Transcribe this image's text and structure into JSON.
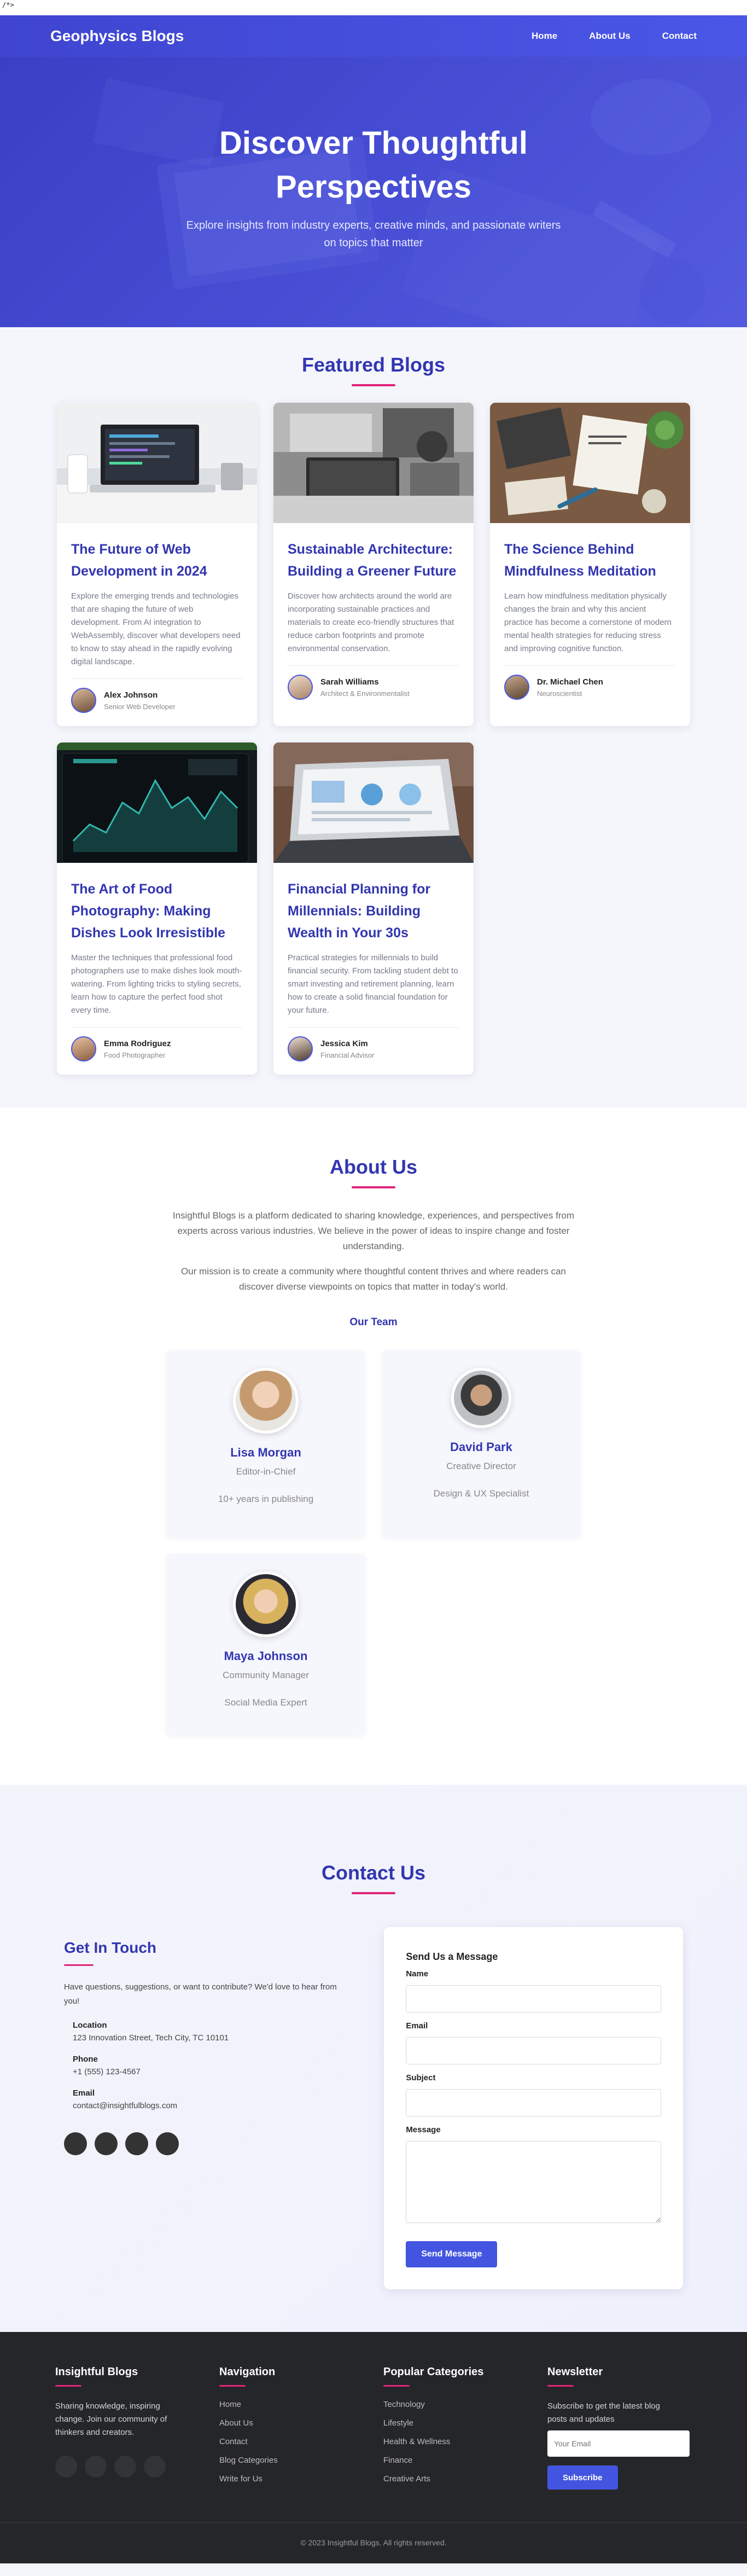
{
  "raw_marker": "/*>",
  "nav": {
    "brand": "Geophysics Blogs",
    "links": [
      "Home",
      "About Us",
      "Contact"
    ]
  },
  "hero": {
    "title": "Discover Thoughtful Perspectives",
    "subtitle": "Explore insights from industry experts, creative minds, and passionate writers on topics that matter"
  },
  "featured": {
    "title": "Featured Blogs",
    "posts": [
      {
        "title": "The Future of Web Development in 2024",
        "excerpt": "Explore the emerging trends and technologies that are shaping the future of web development. From AI integration to WebAssembly, discover what developers need to know to stay ahead in the rapidly evolving digital landscape.",
        "author": "Alex Johnson",
        "role": "Senior Web Developer",
        "image": "laptop-desk-image"
      },
      {
        "title": "Sustainable Architecture: Building a Greener Future",
        "excerpt": "Discover how architects around the world are incorporating sustainable practices and materials to create eco-friendly structures that reduce carbon footprints and promote environmental conservation.",
        "author": "Sarah Williams",
        "role": "Architect & Environmentalist",
        "image": "grayscale-workspace-image"
      },
      {
        "title": "The Science Behind Mindfulness Meditation",
        "excerpt": "Learn how mindfulness meditation physically changes the brain and why this ancient practice has become a cornerstone of modern mental health strategies for reducing stress and improving cognitive function.",
        "author": "Dr. Michael Chen",
        "role": "Neuroscientist",
        "image": "desk-flatlay-image"
      },
      {
        "title": "The Art of Food Photography: Making Dishes Look Irresistible",
        "excerpt": "Master the techniques that professional food photographers use to make dishes look mouth-watering. From lighting tricks to styling secrets, learn how to capture the perfect food shot every time.",
        "author": "Emma Rodriguez",
        "role": "Food Photographer",
        "image": "dashboard-monitor-image"
      },
      {
        "title": "Financial Planning for Millennials: Building Wealth in Your 30s",
        "excerpt": "Practical strategies for millennials to build financial security. From tackling student debt to smart investing and retirement planning, learn how to create a solid financial foundation for your future.",
        "author": "Jessica Kim",
        "role": "Financial Advisor",
        "image": "analytics-laptop-image"
      }
    ]
  },
  "about": {
    "title": "About Us",
    "paragraphs": [
      "Insightful Blogs is a platform dedicated to sharing knowledge, experiences, and perspectives from experts across various industries. We believe in the power of ideas to inspire change and foster understanding.",
      "Our mission is to create a community where thoughtful content thrives and where readers can discover diverse viewpoints on topics that matter in today's world."
    ],
    "team_title": "Our Team",
    "team": [
      {
        "name": "Lisa Morgan",
        "role": "Editor-in-Chief",
        "detail": "10+ years in publishing"
      },
      {
        "name": "David Park",
        "role": "Creative Director",
        "detail": "Design & UX Specialist"
      },
      {
        "name": "Maya Johnson",
        "role": "Community Manager",
        "detail": "Social Media Expert"
      }
    ]
  },
  "contact": {
    "title": "Contact Us",
    "get_in_touch": "Get In Touch",
    "intro": "Have questions, suggestions, or want to contribute? We'd love to hear from you!",
    "info": [
      {
        "label": "Location",
        "value": "123 Innovation Street, Tech City, TC 10101"
      },
      {
        "label": "Phone",
        "value": "+1 (555) 123-4567"
      },
      {
        "label": "Email",
        "value": "contact@insightfulblogs.com"
      }
    ],
    "form": {
      "title": "Send Us a Message",
      "name_label": "Name",
      "email_label": "Email",
      "subject_label": "Subject",
      "message_label": "Message",
      "submit": "Send Message"
    }
  },
  "footer": {
    "about_title": "Insightful Blogs",
    "about_text": "Sharing knowledge, inspiring change. Join our community of thinkers and creators.",
    "nav_title": "Navigation",
    "nav_links": [
      "Home",
      "About Us",
      "Contact",
      "Blog Categories",
      "Write for Us"
    ],
    "cat_title": "Popular Categories",
    "categories": [
      "Technology",
      "Lifestyle",
      "Health & Wellness",
      "Finance",
      "Creative Arts"
    ],
    "newsletter_title": "Newsletter",
    "newsletter_text": "Subscribe to get the latest blog posts and updates",
    "newsletter_placeholder": "Your Email",
    "subscribe": "Subscribe",
    "copyright": "© 2023 Insightful Blogs. All rights reserved."
  },
  "colors": {
    "primary": "#4355e0",
    "heading": "#3236b0",
    "accent": "#e0247a",
    "footer_bg": "#252629"
  }
}
